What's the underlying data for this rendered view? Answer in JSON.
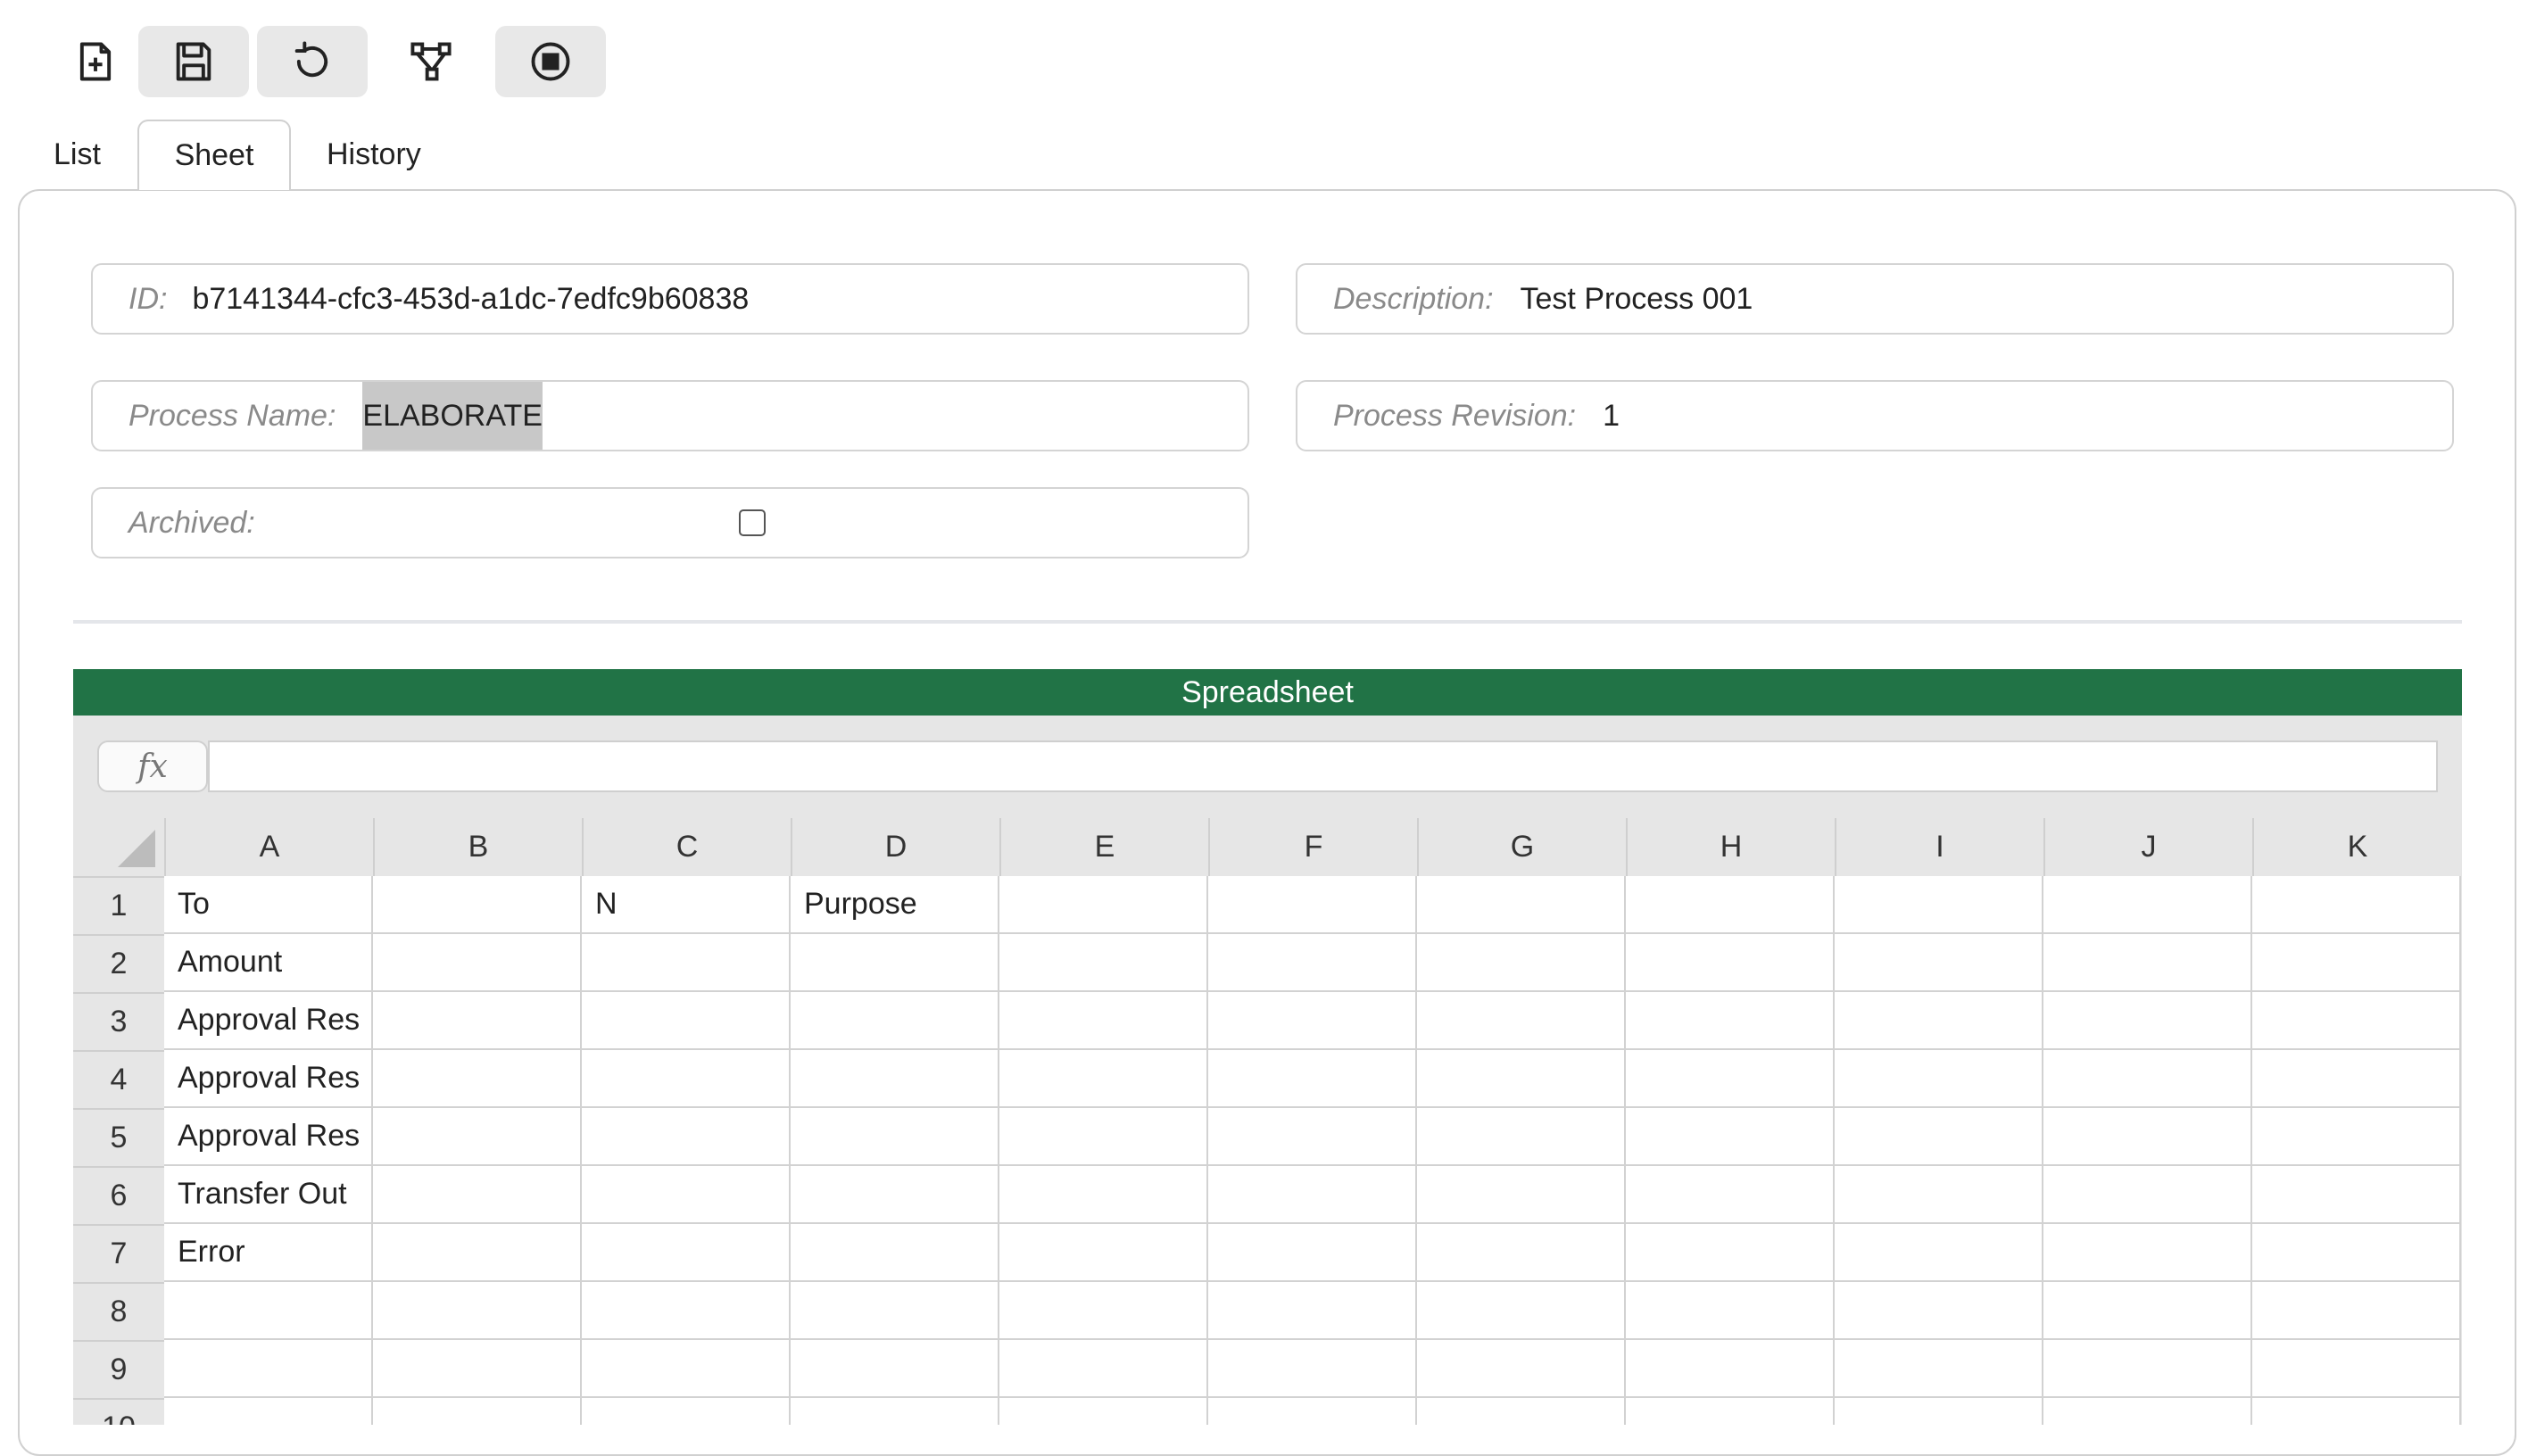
{
  "toolbar": {
    "buttons": [
      {
        "name": "new-file-icon"
      },
      {
        "name": "save-icon"
      },
      {
        "name": "refresh-icon"
      },
      {
        "name": "flow-graph-icon"
      },
      {
        "name": "stop-icon"
      }
    ]
  },
  "tabs": [
    {
      "label": "List"
    },
    {
      "label": "Sheet",
      "active": true
    },
    {
      "label": "History"
    }
  ],
  "form": {
    "id_label": "ID:",
    "id_value": "b7141344-cfc3-453d-a1dc-7edfc9b60838",
    "description_label": "Description:",
    "description_value": "Test Process 001",
    "process_name_label": "Process Name:",
    "process_name_value": "ELABORATE",
    "process_revision_label": "Process Revision:",
    "process_revision_value": "1",
    "archived_label": "Archived:",
    "archived_checked": false
  },
  "spreadsheet": {
    "title": "Spreadsheet",
    "fx_label": "fx",
    "formula_value": "",
    "columns": [
      "A",
      "B",
      "C",
      "D",
      "E",
      "F",
      "G",
      "H",
      "I",
      "J",
      "K"
    ],
    "rows": [
      {
        "n": "1",
        "cells": [
          "To",
          "",
          "N",
          "Purpose",
          "",
          "",
          "",
          "",
          "",
          "",
          ""
        ]
      },
      {
        "n": "2",
        "cells": [
          "Amount",
          "",
          "",
          "",
          "",
          "",
          "",
          "",
          "",
          "",
          ""
        ]
      },
      {
        "n": "3",
        "cells": [
          "Approval Res",
          "",
          "",
          "",
          "",
          "",
          "",
          "",
          "",
          "",
          ""
        ]
      },
      {
        "n": "4",
        "cells": [
          "Approval Res",
          "",
          "",
          "",
          "",
          "",
          "",
          "",
          "",
          "",
          ""
        ]
      },
      {
        "n": "5",
        "cells": [
          "Approval Res",
          "",
          "",
          "",
          "",
          "",
          "",
          "",
          "",
          "",
          ""
        ]
      },
      {
        "n": "6",
        "cells": [
          "Transfer Out",
          "",
          "",
          "",
          "",
          "",
          "",
          "",
          "",
          "",
          ""
        ]
      },
      {
        "n": "7",
        "cells": [
          "Error",
          "",
          "",
          "",
          "",
          "",
          "",
          "",
          "",
          "",
          ""
        ]
      },
      {
        "n": "8",
        "cells": [
          "",
          "",
          "",
          "",
          "",
          "",
          "",
          "",
          "",
          "",
          ""
        ]
      },
      {
        "n": "9",
        "cells": [
          "",
          "",
          "",
          "",
          "",
          "",
          "",
          "",
          "",
          "",
          ""
        ]
      },
      {
        "n": "10",
        "cells": [
          "",
          "",
          "",
          "",
          "",
          "",
          "",
          "",
          "",
          "",
          ""
        ]
      }
    ]
  }
}
